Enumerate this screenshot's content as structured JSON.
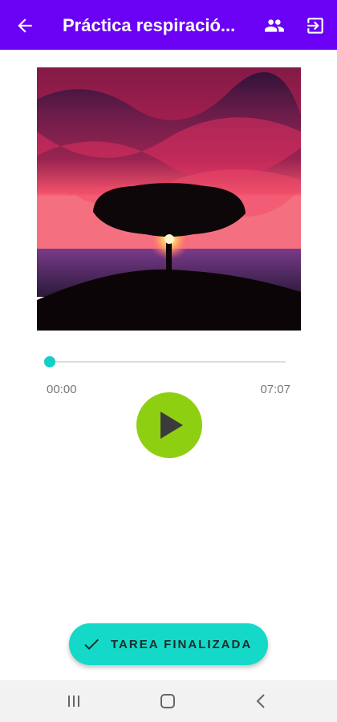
{
  "appbar": {
    "title": "Práctica respiració...",
    "back_icon": "arrow-left-icon",
    "people_icon": "people-icon",
    "logout_icon": "logout-icon",
    "color": "#6a00f4"
  },
  "artwork": {
    "icon": "sunset-tree-image"
  },
  "player": {
    "current_time": "00:00",
    "total_time": "07:07",
    "progress": 0.0,
    "play_icon": "play-icon",
    "play_color": "#8fcf12",
    "accent": "#12d0c6"
  },
  "finish_button": {
    "label": "TAREA FINALIZADA",
    "icon": "check-icon",
    "color": "#14d9c8"
  },
  "system_nav": {
    "recents_icon": "recents-icon",
    "home_icon": "home-icon",
    "back_icon": "back-chevron-icon"
  }
}
